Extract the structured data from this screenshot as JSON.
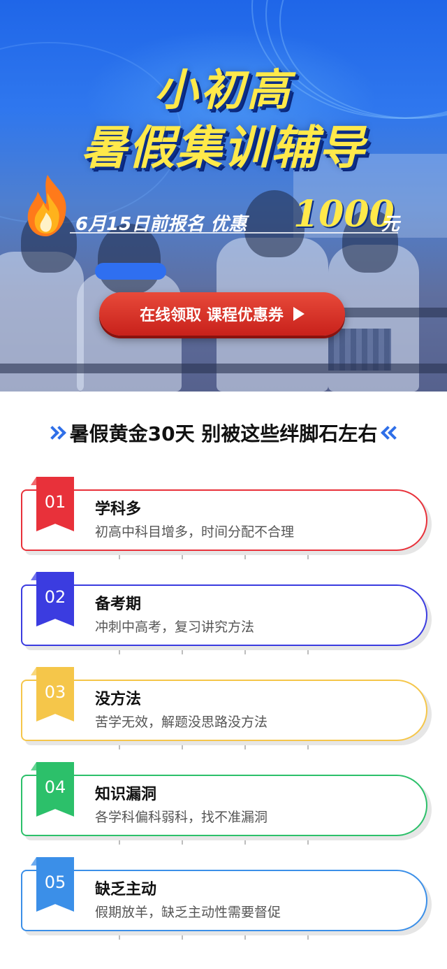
{
  "hero": {
    "title_line1": "小初高",
    "title_line2": "暑假集训辅导",
    "promo_text": "6月15日前报名  优惠",
    "promo_amount": "1000",
    "promo_unit": "元",
    "cta_label": "在线领取 课程优惠券"
  },
  "section": {
    "title": "暑假黄金30天 别被这些绊脚石左右"
  },
  "cards": [
    {
      "num": "01",
      "title": "学科多",
      "desc": "初高中科目增多，时间分配不合理",
      "color": "#e8313a",
      "light": "#f06a6f"
    },
    {
      "num": "02",
      "title": "备考期",
      "desc": "冲刺中高考，复习讲究方法",
      "color": "#3b3ce0",
      "light": "#6f70ec"
    },
    {
      "num": "03",
      "title": "没方法",
      "desc": "苦学无效，解题没思路没方法",
      "color": "#f5c64a",
      "light": "#f8d77c"
    },
    {
      "num": "04",
      "title": "知识漏洞",
      "desc": "各学科偏科弱科，找不准漏洞",
      "color": "#2cc06a",
      "light": "#62d491"
    },
    {
      "num": "05",
      "title": "缺乏主动",
      "desc": "假期放羊，缺乏主动性需要督促",
      "color": "#3b8fe8",
      "light": "#6dabef"
    }
  ]
}
